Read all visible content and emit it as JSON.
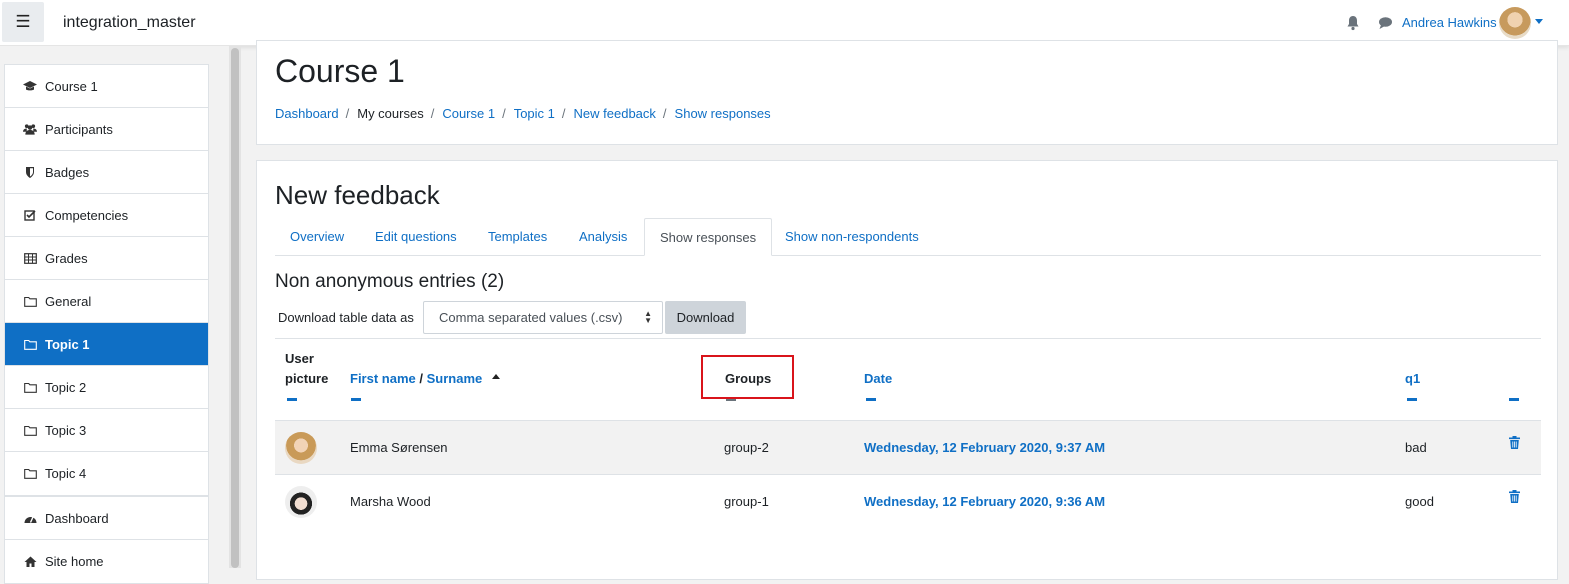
{
  "navbar": {
    "site_name": "integration_master",
    "user_name": "Andrea Hawkins",
    "icons": [
      "menu-icon",
      "bell-icon",
      "chat-icon",
      "user-avatar",
      "caret-down-icon"
    ]
  },
  "sidebar": {
    "course_items": [
      {
        "label": "Course 1",
        "icon": "graduation-cap-icon"
      },
      {
        "label": "Participants",
        "icon": "users-icon"
      },
      {
        "label": "Badges",
        "icon": "shield-icon"
      },
      {
        "label": "Competencies",
        "icon": "checkbox-icon"
      },
      {
        "label": "Grades",
        "icon": "table-icon"
      },
      {
        "label": "General",
        "icon": "folder-icon"
      },
      {
        "label": "Topic 1",
        "icon": "folder-icon",
        "active": true
      },
      {
        "label": "Topic 2",
        "icon": "folder-icon"
      },
      {
        "label": "Topic 3",
        "icon": "folder-icon"
      },
      {
        "label": "Topic 4",
        "icon": "folder-icon"
      }
    ],
    "site_items": [
      {
        "label": "Dashboard",
        "icon": "dashboard-icon"
      },
      {
        "label": "Site home",
        "icon": "home-icon"
      }
    ]
  },
  "header": {
    "title": "Course 1",
    "breadcrumb": [
      "Dashboard",
      "My courses",
      "Course 1",
      "Topic 1",
      "New feedback",
      "Show responses"
    ],
    "separator": "/"
  },
  "main": {
    "title": "New feedback",
    "tabs": [
      "Overview",
      "Edit questions",
      "Templates",
      "Analysis",
      "Show responses",
      "Show non-respondents"
    ],
    "active_tab": "Show responses",
    "entries_title": "Non anonymous entries (2)",
    "download_label": "Download table data as",
    "download_format": "Comma separated values (.csv)",
    "download_button": "Download",
    "table": {
      "headers": {
        "user_picture_1": "User",
        "user_picture_2": "picture",
        "first_name": "First name",
        "name_sep": "/",
        "surname": "Surname",
        "groups": "Groups",
        "date": "Date",
        "q1": "q1"
      },
      "rows": [
        {
          "name": "Emma Sørensen",
          "group": "group-2",
          "date": "Wednesday, 12 February 2020, 9:37 AM",
          "q1": "bad"
        },
        {
          "name": "Marsha Wood",
          "group": "group-1",
          "date": "Wednesday, 12 February 2020, 9:36 AM",
          "q1": "good"
        }
      ]
    }
  },
  "colors": {
    "accent": "#0f6fc5",
    "highlight": "#d9141b"
  }
}
